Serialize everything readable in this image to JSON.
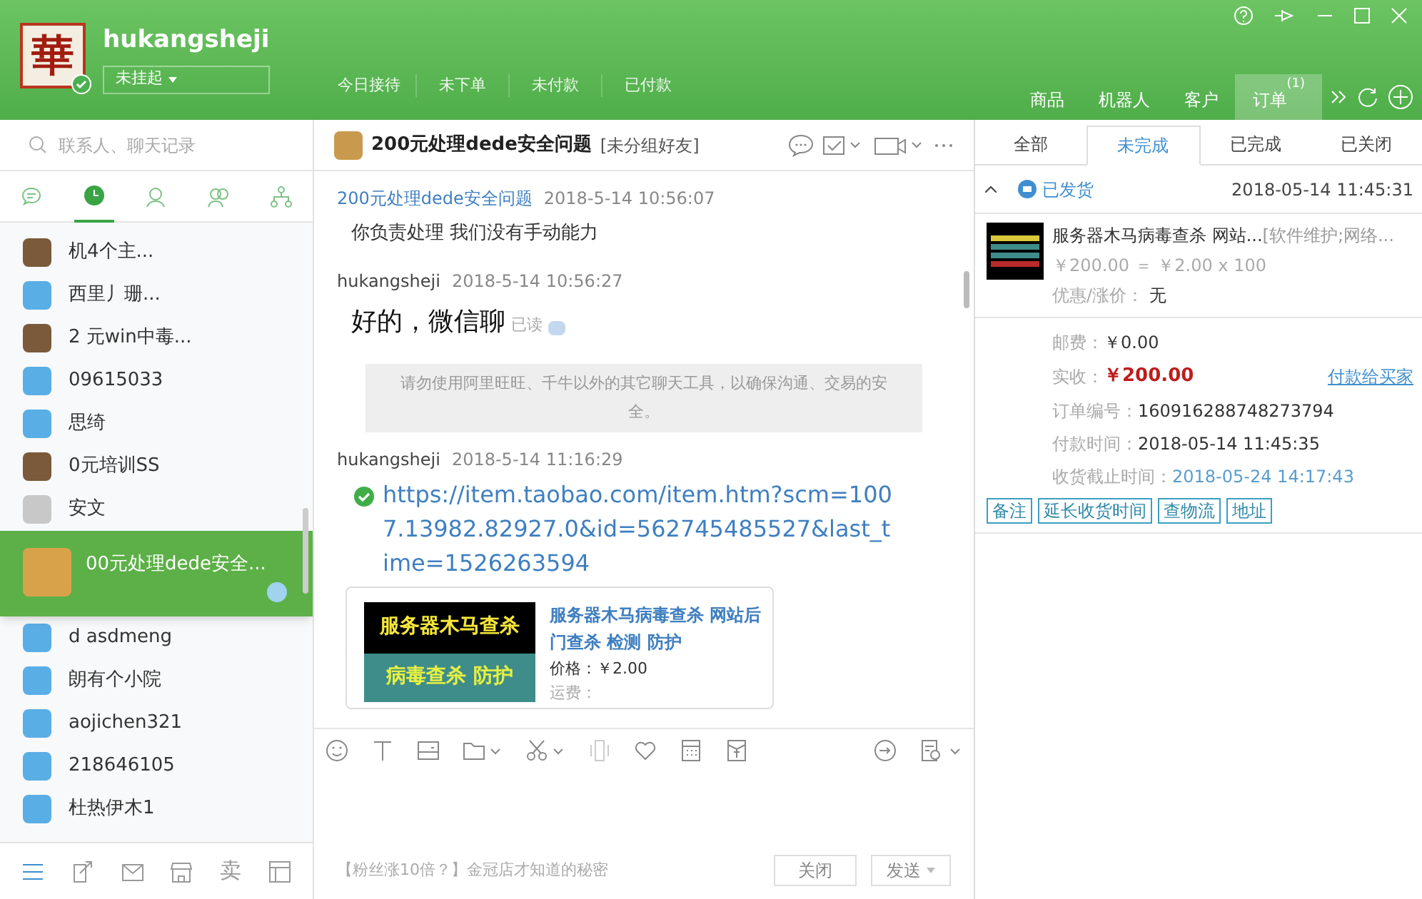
{
  "header": {
    "avatar_text": "華",
    "username": "hukangsheji",
    "status": "未挂起",
    "stats": [
      "今日接待",
      "未下单",
      "未付款",
      "已付款"
    ],
    "tabs": [
      {
        "label": "商品",
        "selected": false
      },
      {
        "label": "机器人",
        "selected": false
      },
      {
        "label": "客户",
        "selected": false
      },
      {
        "label": "订单",
        "badge": "(1)",
        "selected": true
      }
    ]
  },
  "search": {
    "placeholder": "联系人、聊天记录"
  },
  "sidebar_tabs": [
    {
      "kind": "chat",
      "selected": false
    },
    {
      "kind": "recent",
      "selected": true
    },
    {
      "kind": "contact",
      "selected": false
    },
    {
      "kind": "group",
      "selected": false
    },
    {
      "kind": "org",
      "selected": false
    }
  ],
  "contacts": [
    {
      "name": "机4个主...",
      "kind": "photo",
      "selected": false
    },
    {
      "name": "西里丿珊...",
      "kind": "default",
      "selected": false
    },
    {
      "name": "2  元win中毒...",
      "kind": "photo",
      "selected": false
    },
    {
      "name": "09615033",
      "kind": "default",
      "selected": false
    },
    {
      "name": "思绮",
      "kind": "default",
      "selected": false
    },
    {
      "name": "0元培训SS",
      "kind": "photo",
      "selected": false
    },
    {
      "name": "安文",
      "kind": "gray",
      "selected": false
    },
    {
      "name": "00元处理dede安全...",
      "kind": "photo",
      "selected": true
    },
    {
      "name": "d   asdmeng",
      "kind": "default",
      "selected": false
    },
    {
      "name": "朗有个小院",
      "kind": "default",
      "selected": false
    },
    {
      "name": "aojichen321",
      "kind": "default",
      "selected": false
    },
    {
      "name": "218646105",
      "kind": "default",
      "selected": false
    },
    {
      "name": "杜热伊木1",
      "kind": "default",
      "selected": false
    }
  ],
  "bottom_bar": {
    "sell_label": "卖"
  },
  "chat": {
    "title": "200元处理dede安全问题",
    "group": "[未分组好友]",
    "messages": [
      {
        "kind": "text",
        "sender": "200元处理dede安全问题",
        "own": false,
        "time": "2018-5-14 10:56:07",
        "text": "你负责处理 我们没有手动能力"
      },
      {
        "kind": "text",
        "sender": "hukangsheji",
        "own": true,
        "time": "2018-5-14 10:56:27",
        "text": "好的，微信聊",
        "read": "已读"
      },
      {
        "kind": "notice",
        "text": "请勿使用阿里旺旺、千牛以外的其它聊天工具，以确保沟通、交易的安全。"
      },
      {
        "kind": "link",
        "sender": "hukangsheji",
        "own": true,
        "time": "2018-5-14 11:16:29",
        "text": "https://item.taobao.com/item.htm?scm=1007.13982.82927.0&id=562745485527&last_time=1526263594",
        "card": {
          "image_lines": [
            "服务器木马查杀",
            "病毒查杀 防护"
          ],
          "title": "服务器木马病毒查杀 网站后门查杀 检测 防护",
          "price": "价格：￥2.00",
          "shipping": "运费："
        }
      }
    ],
    "ad": "【粉丝涨10倍？】金冠店才知道的秘密",
    "close": "关闭",
    "send": "发送"
  },
  "orders": {
    "tabs": [
      {
        "label": "全部",
        "selected": false
      },
      {
        "label": "未完成",
        "selected": true
      },
      {
        "label": "已完成",
        "selected": false
      },
      {
        "label": "已关闭",
        "selected": false
      }
    ],
    "expanded": true,
    "status": "已发货",
    "time": "2018-05-14 11:45:31",
    "item": {
      "title": "服务器木马病毒查杀 网站...",
      "category": "[软件维护;网络...",
      "price_line": "￥200.00 ＝ ￥2.00 x 100",
      "discount_label": "优惠/涨价：",
      "discount": "无"
    },
    "fields": [
      {
        "kind": "plain",
        "label": "邮费：",
        "value": "￥0.00"
      },
      {
        "kind": "amount",
        "label": "实收：",
        "value": "￥200.00",
        "link": "付款给买家"
      },
      {
        "kind": "plain",
        "label": "订单编号：",
        "value": "160916288748273794"
      },
      {
        "kind": "plain",
        "label": "付款时间：",
        "value": "2018-05-14 11:45:35"
      },
      {
        "kind": "accent",
        "label": "收货截止时间：",
        "value": "2018-05-24 14:17:43"
      }
    ],
    "actions": [
      "备注",
      "延长收货时间",
      "查物流",
      "地址"
    ]
  }
}
